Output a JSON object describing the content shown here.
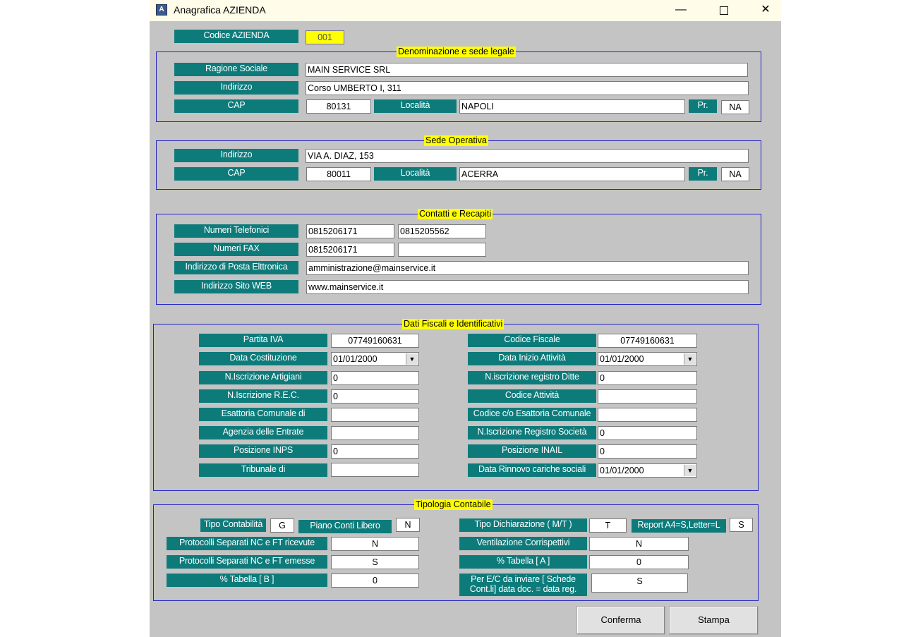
{
  "window": {
    "title": "Anagrafica AZIENDA",
    "icon": "app-icon",
    "icon_letter": "A"
  },
  "codice": {
    "label": "Codice AZIENDA",
    "value": "001"
  },
  "sede_legale": {
    "title": "Denominazione e sede legale",
    "ragione_label": "Ragione Sociale",
    "ragione_value": "MAIN SERVICE SRL",
    "indirizzo_label": "Indirizzo",
    "indirizzo_value": "Corso UMBERTO I, 311",
    "cap_label": "CAP",
    "cap_value": "80131",
    "localita_label": "Località",
    "localita_value": "NAPOLI",
    "pr_label": "Pr.",
    "pr_value": "NA"
  },
  "sede_operativa": {
    "title": "Sede Operativa",
    "indirizzo_label": "Indirizzo",
    "indirizzo_value": "VIA A. DIAZ, 153",
    "cap_label": "CAP",
    "cap_value": "80011",
    "localita_label": "Località",
    "localita_value": "ACERRA",
    "pr_label": "Pr.",
    "pr_value": "NA"
  },
  "contatti": {
    "title": "Contatti e Recapiti",
    "tel_label": "Numeri Telefonici",
    "tel1": "0815206171",
    "tel2": "0815205562",
    "fax_label": "Numeri FAX",
    "fax1": "0815206171",
    "fax2": "",
    "email_label": "Indirizzo di Posta Elttronica",
    "email_value": "amministrazione@mainservice.it",
    "web_label": "Indirizzo Sito WEB",
    "web_value": "www.mainservice.it"
  },
  "fiscali": {
    "title": "Dati Fiscali e Identificativi",
    "left": [
      {
        "label": "Partita IVA",
        "value": "07749160631"
      },
      {
        "label": "Data Costituzione",
        "value": "01/01/2000"
      },
      {
        "label": "N.Iscrizione Artigiani",
        "value": "0"
      },
      {
        "label": "N.Iscrizione R.E.C.",
        "value": "0"
      },
      {
        "label": "Esattoria Comunale di",
        "value": ""
      },
      {
        "label": "Agenzia delle Entrate",
        "value": ""
      },
      {
        "label": "Posizione INPS",
        "value": "0"
      },
      {
        "label": "Tribunale di",
        "value": ""
      }
    ],
    "right": [
      {
        "label": "Codice Fiscale",
        "value": "07749160631"
      },
      {
        "label": "Data Inizio Attività",
        "value": "01/01/2000"
      },
      {
        "label": "N.iscrizione registro Ditte",
        "value": "0"
      },
      {
        "label": "Codice Attività",
        "value": ""
      },
      {
        "label": "Codice c/o Esattoria Comunale",
        "value": ""
      },
      {
        "label": "N.Iscrizione Registro Società",
        "value": "0"
      },
      {
        "label": "Posizione INAIL",
        "value": "0"
      },
      {
        "label": "Data Rinnovo cariche sociali",
        "value": "01/01/2000"
      }
    ]
  },
  "tipologia": {
    "title": "Tipologia Contabile",
    "tipo_cont_label": "Tipo Contabilità",
    "tipo_cont_value": "G",
    "piano_label": "Piano Conti Libero",
    "piano_value": "N",
    "proto_ric_label": "Protocolli Separati  NC e FT ricevute",
    "proto_ric_value": "N",
    "proto_em_label": "Protocolli Separati NC e FT emesse",
    "proto_em_value": "S",
    "tab_b_label": "% Tabella [ B ]",
    "tab_b_value": "0",
    "tipo_dich_label": "Tipo Dichiarazione ( M/T )",
    "tipo_dich_value": "T",
    "report_label": "Report A4=S,Letter=L",
    "report_value": "S",
    "ventil_label": "Ventilazione Corrispettivi",
    "ventil_value": "N",
    "tab_a_label": "% Tabella [ A ]",
    "tab_a_value": "0",
    "ec_label_1": "Per E/C da inviare [ Schede",
    "ec_label_2": "Cont.li] data doc. = data reg.",
    "ec_value": "S"
  },
  "buttons": {
    "conferma": "Conferma",
    "stampa": "Stampa"
  },
  "dropdown_glyph": "▼"
}
